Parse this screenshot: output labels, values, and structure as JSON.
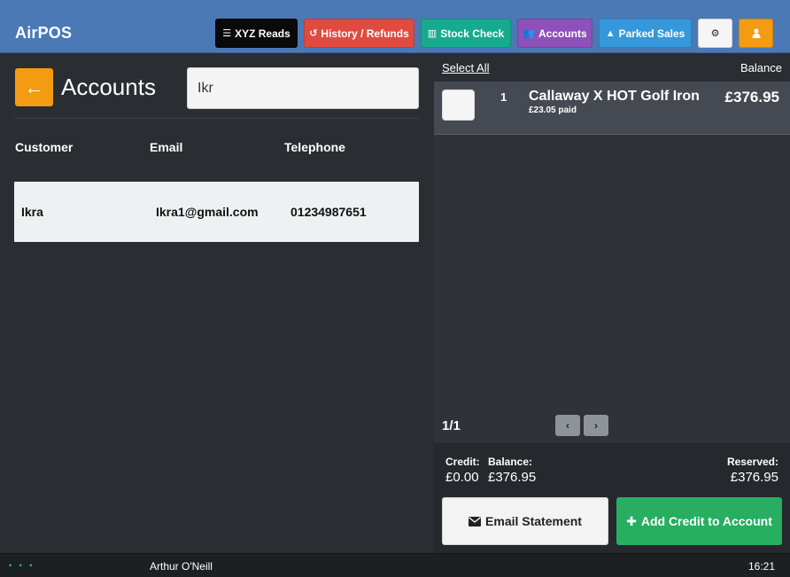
{
  "app": {
    "title": "AirPOS"
  },
  "nav": {
    "xyz_reads": "XYZ Reads",
    "history_refunds": "History / Refunds",
    "stock_check": "Stock Check",
    "accounts": "Accounts",
    "parked_sales": "Parked Sales"
  },
  "accounts_page": {
    "title": "Accounts",
    "search": {
      "value": "Ikr",
      "placeholder": ""
    },
    "columns": {
      "customer": "Customer",
      "email": "Email",
      "telephone": "Telephone"
    },
    "rows": [
      {
        "customer": "Ikra",
        "email": "Ikra1@gmail.com",
        "telephone": "01234987651"
      }
    ]
  },
  "account_detail": {
    "select_all": "Select All",
    "balance_label": "Balance",
    "items": [
      {
        "qty": "1",
        "name": "Callaway X HOT Golf Iron",
        "paid": "£23.05 paid",
        "balance": "£376.95"
      }
    ],
    "pager": {
      "text": "1/1",
      "prev": "‹",
      "next": "›"
    },
    "summary": {
      "credit_label": "Credit:",
      "credit_value": "£0.00",
      "balance_label": "Balance:",
      "balance_value": "£376.95",
      "reserved_label": "Reserved:",
      "reserved_value": "£376.95"
    },
    "actions": {
      "email_statement": "Email Statement",
      "add_credit": "Add Credit to Account"
    }
  },
  "status_bar": {
    "indicator": "• • •",
    "operator": "Arthur O'Neill",
    "time": "16:21"
  },
  "colors": {
    "topbar": "#4a79b5",
    "xyz": "#0a0a0a",
    "history": "#e04b3f",
    "stock": "#16ab8e",
    "accounts": "#8e50b9",
    "parked": "#3498db",
    "user": "#f39c12",
    "credit_button": "#27ae60"
  },
  "icons": {
    "xyz_reads": "list-icon",
    "history": "history-icon",
    "stock": "barcode-icon",
    "accounts": "users-icon",
    "parked": "road-icon",
    "settings": "gear-icon",
    "user": "user-icon",
    "back": "arrow-left-icon",
    "email": "envelope-icon",
    "add": "plus-icon"
  }
}
